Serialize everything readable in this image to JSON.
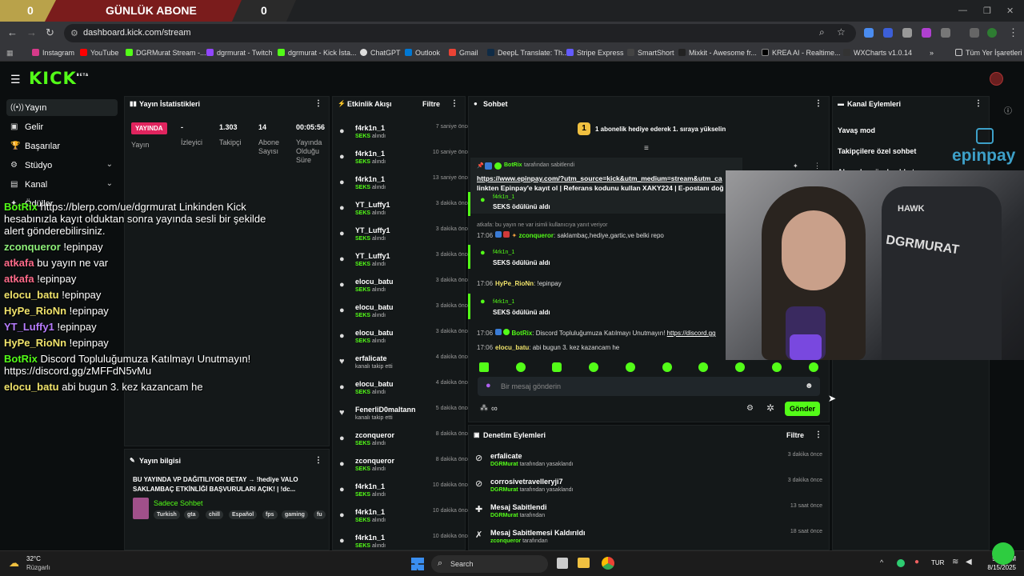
{
  "sub_counter": {
    "left": "0",
    "title": "GÜNLÜK ABONE",
    "right": "0"
  },
  "browser": {
    "url": "dashboard.kick.com/stream",
    "all_bookmarks": "Tüm Yer İşaretleri"
  },
  "bookmarks": [
    "Instagram",
    "YouTube",
    "DGRMurat Stream -...",
    "dgrmurat - Twitch",
    "dgrmurat - Kick İsta...",
    "ChatGPT",
    "Outlook",
    "Gmail",
    "DeepL Translate: Th...",
    "Stripe Express",
    "SmartShort",
    "Mixkit - Awesome fr...",
    "KREA AI - Realtime...",
    "WXCharts v1.0.14"
  ],
  "kick": {
    "logo": "KICK",
    "beta": "BETA"
  },
  "nav": [
    {
      "label": "Yayın",
      "icon": "broadcast-icon"
    },
    {
      "label": "Gelir",
      "icon": "money-icon"
    },
    {
      "label": "Başarılar",
      "icon": "trophy-icon"
    },
    {
      "label": "Stüdyo",
      "icon": "studio-icon"
    },
    {
      "label": "Kanal",
      "icon": "channel-icon"
    },
    {
      "label": "Ödüller",
      "icon": "reward-icon"
    }
  ],
  "overlay_chat": [
    {
      "user": "BotRix",
      "color": "#53fc18",
      "text": "https://blerp.com/ue/dgrmurat Linkinden Kick"
    },
    {
      "user": "",
      "color": "#fff",
      "text": "hesabınızla kayıt olduktan sonra yayında sesli bir şekilde"
    },
    {
      "user": "",
      "color": "#fff",
      "text": "alert gönderebilirsiniz."
    },
    {
      "user": "zconqueror",
      "color": "#8ef07a",
      "text": "!epinpay"
    },
    {
      "user": "atkafa",
      "color": "#ff6b8a",
      "text": "bu yayın ne var"
    },
    {
      "user": "atkafa",
      "color": "#ff6b8a",
      "text": "!epinpay"
    },
    {
      "user": "elocu_batu",
      "color": "#f0e36b",
      "text": "!epinpay"
    },
    {
      "user": "HyPe_RioNn",
      "color": "#f0e36b",
      "text": "!epinpay"
    },
    {
      "user": "YT_Luffy1",
      "color": "#b77cff",
      "text": "!epinpay"
    },
    {
      "user": "HyPe_RioNn",
      "color": "#f0e36b",
      "text": "!epinpay"
    },
    {
      "user": "BotRix",
      "color": "#53fc18",
      "text": "Discord Topluluğumuza Katılmayı Unutmayın!"
    },
    {
      "user": "",
      "color": "#fff",
      "text": "https://discord.gg/zMFFdN5vMu"
    },
    {
      "user": "elocu_batu",
      "color": "#f0e36b",
      "text": "abi bugun 3. kez kazancam he"
    }
  ],
  "stats": {
    "title": "Yayın İstatistikleri",
    "live_badge": "YAYINDA",
    "live_label": "Yayın",
    "viewers_val": "-",
    "viewers_lbl": "İzleyici",
    "followers_val": "1.303",
    "followers_lbl": "Takipçi",
    "subs_val": "14",
    "subs_lbl1": "Abone",
    "subs_lbl2": "Sayısı",
    "dur_val": "00:05:56",
    "dur_lbl1": "Yayında",
    "dur_lbl2": "Olduğu",
    "dur_lbl3": "Süre"
  },
  "stream_info": {
    "title": "Yayın bilgisi",
    "line1": "BU YAYINDA VP DAĞITILIYOR DETAY → !hediye VALO",
    "line2": "SAKLAMBAÇ ETKİNLİĞİ BAŞVURULARI AÇIK! | !dc...",
    "category": "Sadece Sohbet",
    "tags": [
      "Turkish",
      "gta",
      "chill",
      "Español",
      "fps",
      "gaming",
      "fu"
    ]
  },
  "events": {
    "title": "Etkinlik Akışı",
    "filter": "Filtre",
    "items": [
      {
        "name": "f4rk1n_1",
        "sub_pre": "SEKS",
        "sub": " alındı",
        "time": "7 saniye önce",
        "icon": "reward-icon"
      },
      {
        "name": "f4rk1n_1",
        "sub_pre": "SEKS",
        "sub": " alındı",
        "time": "10 saniye önce",
        "icon": "reward-icon"
      },
      {
        "name": "f4rk1n_1",
        "sub_pre": "SEKS",
        "sub": " alındı",
        "time": "13 saniye önce",
        "icon": "reward-icon"
      },
      {
        "name": "YT_Luffy1",
        "sub_pre": "SEKS",
        "sub": " alındı",
        "time": "3 dakika önce",
        "icon": "reward-icon"
      },
      {
        "name": "YT_Luffy1",
        "sub_pre": "SEKS",
        "sub": " alındı",
        "time": "3 dakika önce",
        "icon": "reward-icon"
      },
      {
        "name": "YT_Luffy1",
        "sub_pre": "SEKS",
        "sub": " alındı",
        "time": "3 dakika önce",
        "icon": "reward-icon"
      },
      {
        "name": "elocu_batu",
        "sub_pre": "SEKS",
        "sub": " alındı",
        "time": "3 dakika önce",
        "icon": "reward-icon"
      },
      {
        "name": "elocu_batu",
        "sub_pre": "SEKS",
        "sub": " alındı",
        "time": "3 dakika önce",
        "icon": "reward-icon"
      },
      {
        "name": "elocu_batu",
        "sub_pre": "SEKS",
        "sub": " alındı",
        "time": "3 dakika önce",
        "icon": "reward-icon"
      },
      {
        "name": "erfalicate",
        "sub_pre": "",
        "sub": "kanalı takip etti",
        "time": "4 dakika önce",
        "icon": "heart-icon"
      },
      {
        "name": "elocu_batu",
        "sub_pre": "SEKS",
        "sub": " alındı",
        "time": "4 dakika önce",
        "icon": "reward-icon"
      },
      {
        "name": "FenerliD0maltann",
        "sub_pre": "",
        "sub": "kanalı takip etti",
        "time": "5 dakika önce",
        "icon": "heart-icon"
      },
      {
        "name": "zconqueror",
        "sub_pre": "SEKS",
        "sub": " alındı",
        "time": "8 dakika önce",
        "icon": "reward-icon"
      },
      {
        "name": "zconqueror",
        "sub_pre": "SEKS",
        "sub": " alındı",
        "time": "8 dakika önce",
        "icon": "reward-icon"
      },
      {
        "name": "f4rk1n_1",
        "sub_pre": "SEKS",
        "sub": " alındı",
        "time": "10 dakika önce",
        "icon": "reward-icon"
      },
      {
        "name": "f4rk1n_1",
        "sub_pre": "SEKS",
        "sub": " alındı",
        "time": "10 dakika önce",
        "icon": "reward-icon"
      },
      {
        "name": "f4rk1n_1",
        "sub_pre": "SEKS",
        "sub": " alındı",
        "time": "10 dakika önce",
        "icon": "reward-icon"
      }
    ]
  },
  "chat": {
    "title": "Sohbet",
    "gift_banner": "1 abonelik hediye ederek 1. sıraya yükselin",
    "gift_rank": "1",
    "pinned_by_user": "BotRix",
    "pinned_by_suffix": "tarafından sabitlendi",
    "pinned_link": "https://www.epinpay.com/?utm_source=kick&utm_medium=stream&utm_ca",
    "pinned_text": "linkten Epinpay'e kayıt ol | Referans kodunu kullan XAKY224 | E-postanı doğ",
    "r1_user": "f4rk1n_1",
    "r1_text": "SEKS ödülünü aldı",
    "reply_note": "atkafa: bu yayın ne var isimli kullanıcıya yanıt veriyor",
    "m1_time": "17:06",
    "m1_user": "zconqueror",
    "m1_text": ": saklambaç,hediye,gartic,ve belki repo",
    "r2_user": "f4rk1n_1",
    "r2_text": "SEKS ödülünü aldı",
    "m2_time": "17:06",
    "m2_user": "HyPe_RioNn",
    "m2_text": ": !epinpay",
    "r3_user": "f4rk1n_1",
    "r3_text": "SEKS ödülünü aldı",
    "m3_time": "17:06",
    "m3_user": "BotRix",
    "m3_text": ": Discord Topluluğumuza Katılmayı Unutmayın! ",
    "m3_link": "https://discord.gg",
    "m4_time": "17:06",
    "m4_user": "elocu_batu",
    "m4_text": ": abi bugun 3. kez kazancam he",
    "input_placeholder": "Bir mesaj gönderin",
    "send": "Gönder",
    "points": "∞"
  },
  "mod": {
    "title": "Denetim Eylemleri",
    "filter": "Filtre",
    "items": [
      {
        "name": "erfalicate",
        "by": "DGRMurat",
        "suffix": " tarafından yasaklandı",
        "time": "3 dakika önce",
        "icon": "ban-icon"
      },
      {
        "name": "corrosivetravelleryji7",
        "by": "DGRMurat",
        "suffix": " tarafından yasaklandı",
        "time": "3 dakika önce",
        "icon": "ban-icon"
      },
      {
        "name": "Mesaj Sabitlendi",
        "by": "DGRMurat",
        "suffix": " tarafından",
        "time": "13 saat önce",
        "icon": "pin-icon"
      },
      {
        "name": "Mesaj Sabitlemesi Kaldırıldı",
        "by": "zconqueror",
        "suffix": " tarafından",
        "time": "18 saat önce",
        "icon": "unpin-icon"
      }
    ]
  },
  "channel_actions": {
    "title": "Kanal Eylemleri",
    "items": [
      "Yavaş mod",
      "Takipçilere özel sohbet",
      "Abonelere özel sohbet"
    ]
  },
  "webcam": {
    "brand": "epinpay",
    "chair_brand": "HAWK",
    "chair_name": "DGRMURAT"
  },
  "taskbar": {
    "temp": "32°C",
    "weather": "Rüzgarlı",
    "search": "Search",
    "lang": "TUR",
    "time": "5:06 PM",
    "date": "8/15/2025"
  },
  "colors": {
    "kick_green": "#53fc18",
    "live_red": "#e0245e"
  }
}
